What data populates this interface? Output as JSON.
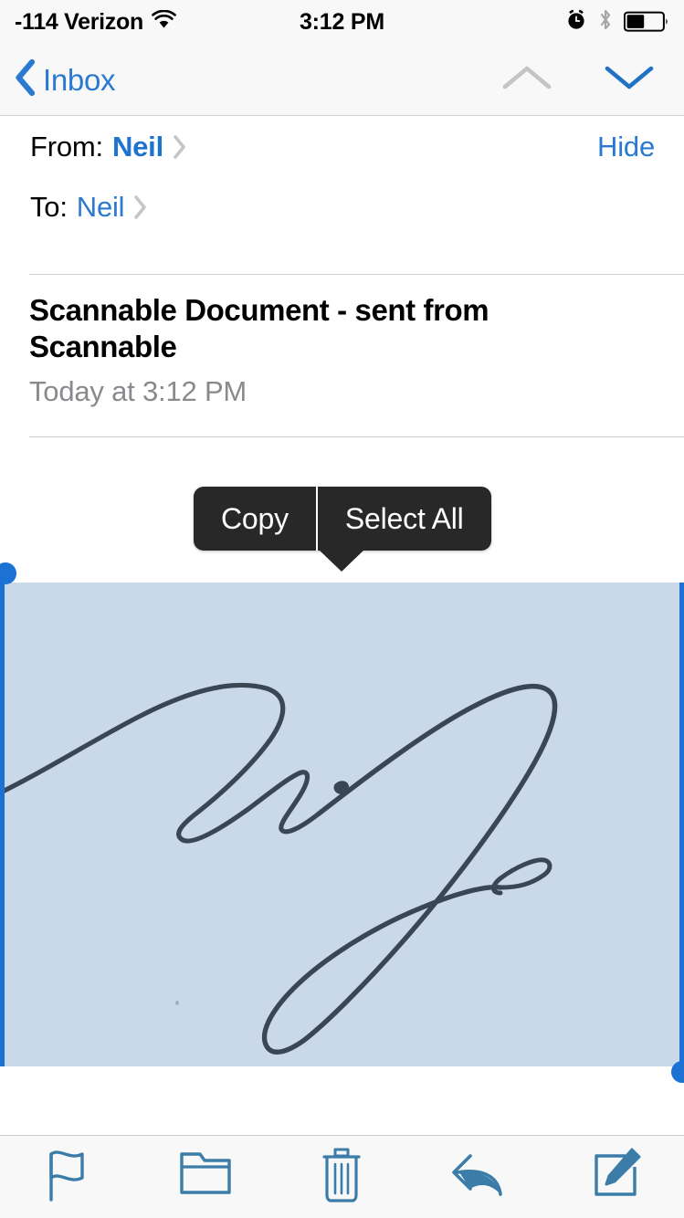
{
  "status_bar": {
    "carrier": "-114 Verizon",
    "time": "3:12 PM",
    "icons": [
      "wifi-icon",
      "alarm-clock-icon",
      "bluetooth-icon",
      "battery-icon"
    ],
    "battery_level_percent": 50
  },
  "nav_bar": {
    "back_label": "Inbox",
    "prev_message_icon": "chevron-up-icon",
    "next_message_icon": "chevron-down-icon",
    "prev_enabled": false,
    "next_enabled": true
  },
  "header": {
    "from_label": "From:",
    "from_value": "Neil",
    "to_label": "To:",
    "to_value": "Neil",
    "hide_label": "Hide"
  },
  "message": {
    "subject": "Scannable Document - sent from Scannable",
    "date": "Today at 3:12 PM"
  },
  "edit_menu": {
    "copy_label": "Copy",
    "select_all_label": "Select All"
  },
  "selection": {
    "handle_start_icon": "selection-handle-start",
    "handle_end_icon": "selection-handle-end",
    "attachment_description": "Scanned handwritten signature"
  },
  "toolbar": {
    "items": [
      {
        "name": "flag-icon",
        "label": "Flag"
      },
      {
        "name": "folder-icon",
        "label": "Move to folder"
      },
      {
        "name": "trash-icon",
        "label": "Delete"
      },
      {
        "name": "reply-icon",
        "label": "Reply"
      },
      {
        "name": "compose-icon",
        "label": "Compose"
      }
    ]
  },
  "colors": {
    "tint_blue": "#2b7ad1",
    "selection_highlight": "#c9d9ea",
    "handle_blue": "#1b72d4",
    "menu_background": "#282828",
    "toolbar_icon": "#3b7ca8",
    "chrome_background": "#f8f8f8",
    "secondary_text": "#8a8a8e"
  }
}
